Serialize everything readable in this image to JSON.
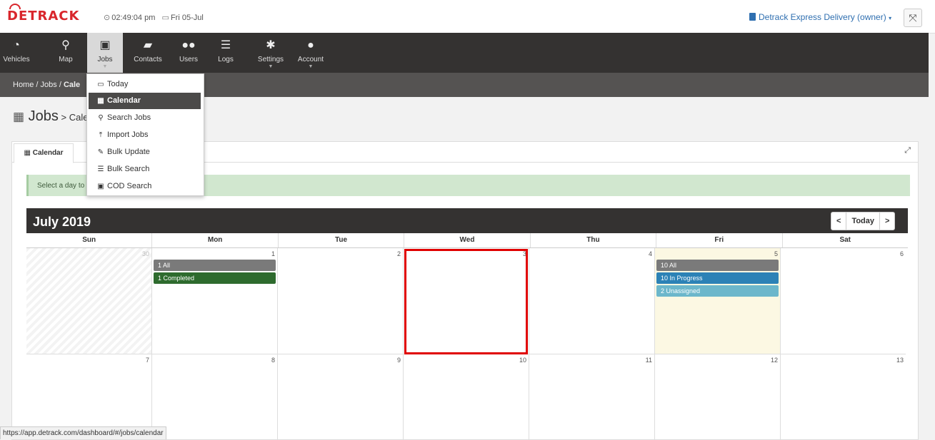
{
  "app": {
    "logo": "DETRACK",
    "time": "02:49:04 pm",
    "date": "Fri 05-Jul",
    "owner": "Detrack Express Delivery (owner)"
  },
  "nav": {
    "items": [
      {
        "label": "Vehicles",
        "icon": "dashboard-icon"
      },
      {
        "label": "Map",
        "icon": "map-marker-icon"
      },
      {
        "label": "Jobs",
        "icon": "briefcase-icon"
      },
      {
        "label": "Contacts",
        "icon": "book-icon"
      },
      {
        "label": "Users",
        "icon": "users-icon"
      },
      {
        "label": "Logs",
        "icon": "list-icon"
      },
      {
        "label": "Settings",
        "icon": "gear-icon"
      },
      {
        "label": "Account",
        "icon": "user-icon"
      }
    ]
  },
  "breadcrumb": {
    "home": "Home",
    "jobs": "Jobs",
    "current": "Cale"
  },
  "page": {
    "title": "Jobs",
    "subtitle": "Cale"
  },
  "tabs": {
    "calendar": "Calendar"
  },
  "alert": {
    "text": "Select a day to"
  },
  "menu": {
    "items": [
      "Today",
      "Calendar",
      "Search Jobs",
      "Import Jobs",
      "Bulk Update",
      "Bulk Search",
      "COD Search"
    ]
  },
  "calendar": {
    "month": "July 2019",
    "prev": "<",
    "today": "Today",
    "next": ">",
    "days": [
      "Sun",
      "Mon",
      "Tue",
      "Wed",
      "Thu",
      "Fri",
      "Sat"
    ],
    "week1": [
      "30",
      "1",
      "2",
      "3",
      "4",
      "5",
      "6"
    ],
    "week2": [
      "7",
      "8",
      "9",
      "10",
      "11",
      "12",
      "13"
    ],
    "events": {
      "mon_all": "1 All",
      "mon_completed": "1 Completed",
      "fri_all": "10 All",
      "fri_progress": "10 In Progress",
      "fri_unassigned": "2 Unassigned"
    }
  },
  "status_url": "https://app.detrack.com/dashboard/#/jobs/calendar"
}
